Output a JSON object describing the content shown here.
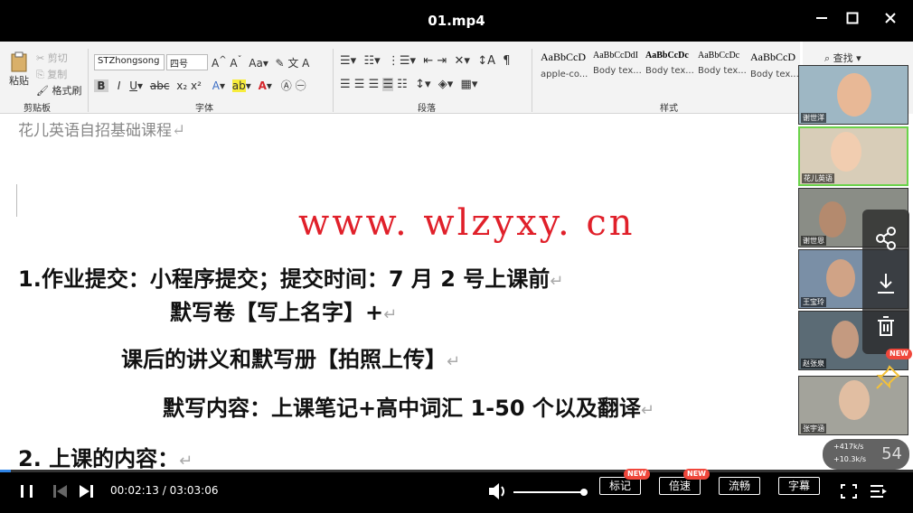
{
  "window": {
    "title": "01.mp4",
    "minimize_glyph": "—",
    "maximize_glyph": "☐",
    "close_glyph": "✕"
  },
  "ribbon": {
    "clipboard": {
      "paste_label": "粘贴",
      "cut_label": "剪切",
      "copy_label": "复制",
      "format_painter_label": "格式刷",
      "group_label": "剪贴板"
    },
    "font": {
      "font_name": "STZhongsong",
      "font_size": "四号",
      "group_label": "字体"
    },
    "paragraph": {
      "group_label": "段落"
    },
    "styles": {
      "group_label": "样式",
      "cards": [
        {
          "sample": "AaBbCcD",
          "name": "apple-co..."
        },
        {
          "sample": "AaBbCcDdI",
          "name": "Body tex..."
        },
        {
          "sample": "AaBbCcDc",
          "name": "Body tex..."
        },
        {
          "sample": "AaBbCcDc",
          "name": "Body tex..."
        },
        {
          "sample": "AaBbCcD",
          "name": "Body tex..."
        }
      ]
    },
    "find_label": "查找"
  },
  "document": {
    "subtitle": "花儿英语自招基础课程",
    "line1": "1.作业提交：小程序提交；提交时间：7 月 2 号上课前",
    "line2": "默写卷【写上名字】+",
    "line3": "课后的讲义和默写册【拍照上传】",
    "line4": "默写内容：上课笔记+高中词汇 1-50 个以及翻译",
    "line5": "2. 上课的内容：",
    "return_mark": "↵"
  },
  "watermark": "www. wlzyxy. cn",
  "participants": [
    {
      "name": "谢世洋",
      "bg": "#9eb7c4",
      "face": "#e8b896"
    },
    {
      "name": "花儿英语",
      "bg": "#d8cdb8",
      "face": "#f1cdb0"
    },
    {
      "name": "谢世恩",
      "bg": "#8a8d86",
      "face": "#b48a6e"
    },
    {
      "name": "王宝玲",
      "bg": "#7a8fa6",
      "face": "#d0a386"
    },
    {
      "name": "赵张泉",
      "bg": "#5b6b75",
      "face": "#c49a80"
    },
    {
      "name": "张宇涵",
      "bg": "#a3a39b",
      "face": "#e1bea2"
    }
  ],
  "side_actions": [
    "share-icon",
    "download-icon",
    "trash-icon",
    "pin-icon"
  ],
  "netstats": {
    "up": "+417k/s",
    "down": "+10.3k/s",
    "speed": "54"
  },
  "player": {
    "current_time": "00:02:13",
    "total_time": "03:03:06",
    "time_separator": " / ",
    "progress_fraction": 0.012,
    "volume_fraction": 1.0,
    "mark_label": "标记",
    "speed_label": "倍速",
    "quality_label": "流畅",
    "subtitle_label": "字幕",
    "new_badge": "NEW",
    "accent_color": "#2f84e5"
  }
}
